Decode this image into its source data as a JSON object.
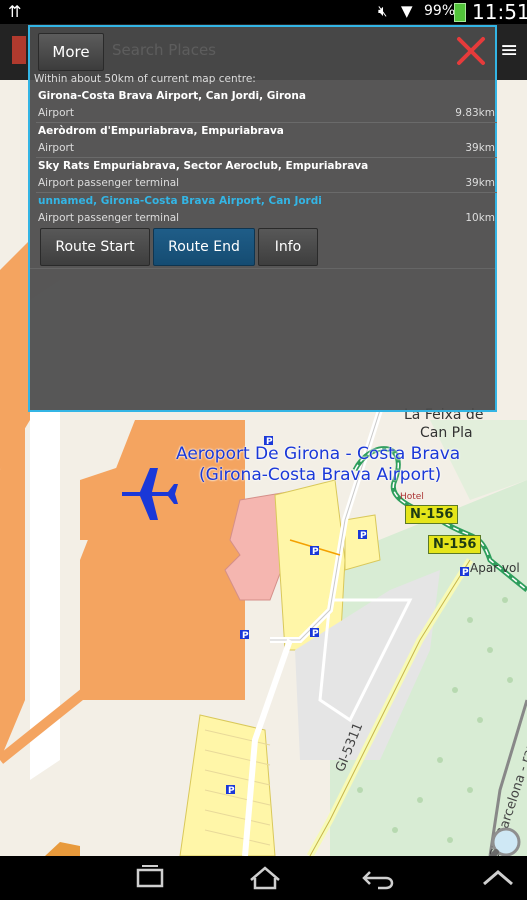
{
  "status_bar": {
    "usb_icon": "usb-icon",
    "mute_icon": "mute-icon",
    "wifi_icon": "wifi-icon",
    "battery_percent": "99%",
    "time": "11:51"
  },
  "map": {
    "airport_name_line1": "Aeroport De Girona - Costa Brava",
    "airport_name_line2": "(Girona-Costa Brava Airport)",
    "place_la_feixa": "La Feixa de",
    "place_can_pla": "Can Pla",
    "road_n156_a": "N-156",
    "road_n156_b": "N-156",
    "road_gi_label": "GI-5311",
    "apartment_label": "Apar vol",
    "lgv_label": "LGV Barcelona - rança",
    "hotel_label": "Hotel",
    "colors": {
      "land": "#f3efe6",
      "apron": "#f4a460",
      "terminal": "#f5b6b0",
      "parking": "#fff8b0",
      "woods": "#d6ecd2",
      "route_green": "#2e9e5c",
      "airport_label": "#1a38d8"
    }
  },
  "dialog": {
    "more_label": "More",
    "faded_title": "Search Places",
    "close_icon": "close-icon",
    "subtitle": "Within about 50km of current map centre:",
    "results": [
      {
        "name": "Girona-Costa Brava Airport, Can Jordi, Girona",
        "type": "Airport",
        "distance": "9.83km",
        "highlight": false
      },
      {
        "name": "Aeròdrom d'Empuriabrava, Empuriabrava",
        "type": "Airport",
        "distance": "39km",
        "highlight": false
      },
      {
        "name": "Sky Rats Empuriabrava, Sector Aeroclub, Empuriabrava",
        "type": "Airport passenger terminal",
        "distance": "39km",
        "highlight": false
      },
      {
        "name": "unnamed, Girona-Costa Brava Airport, Can Jordi",
        "type": "Airport passenger terminal",
        "distance": "10km",
        "highlight": true
      }
    ],
    "buttons": {
      "route_start": "Route Start",
      "route_end": "Route End",
      "info": "Info"
    },
    "accent_color": "#33b5e5"
  },
  "nav_bar": {
    "recent_icon": "recent-apps-icon",
    "home_icon": "home-icon",
    "back_icon": "back-icon",
    "up_icon": "chevron-up-icon"
  }
}
